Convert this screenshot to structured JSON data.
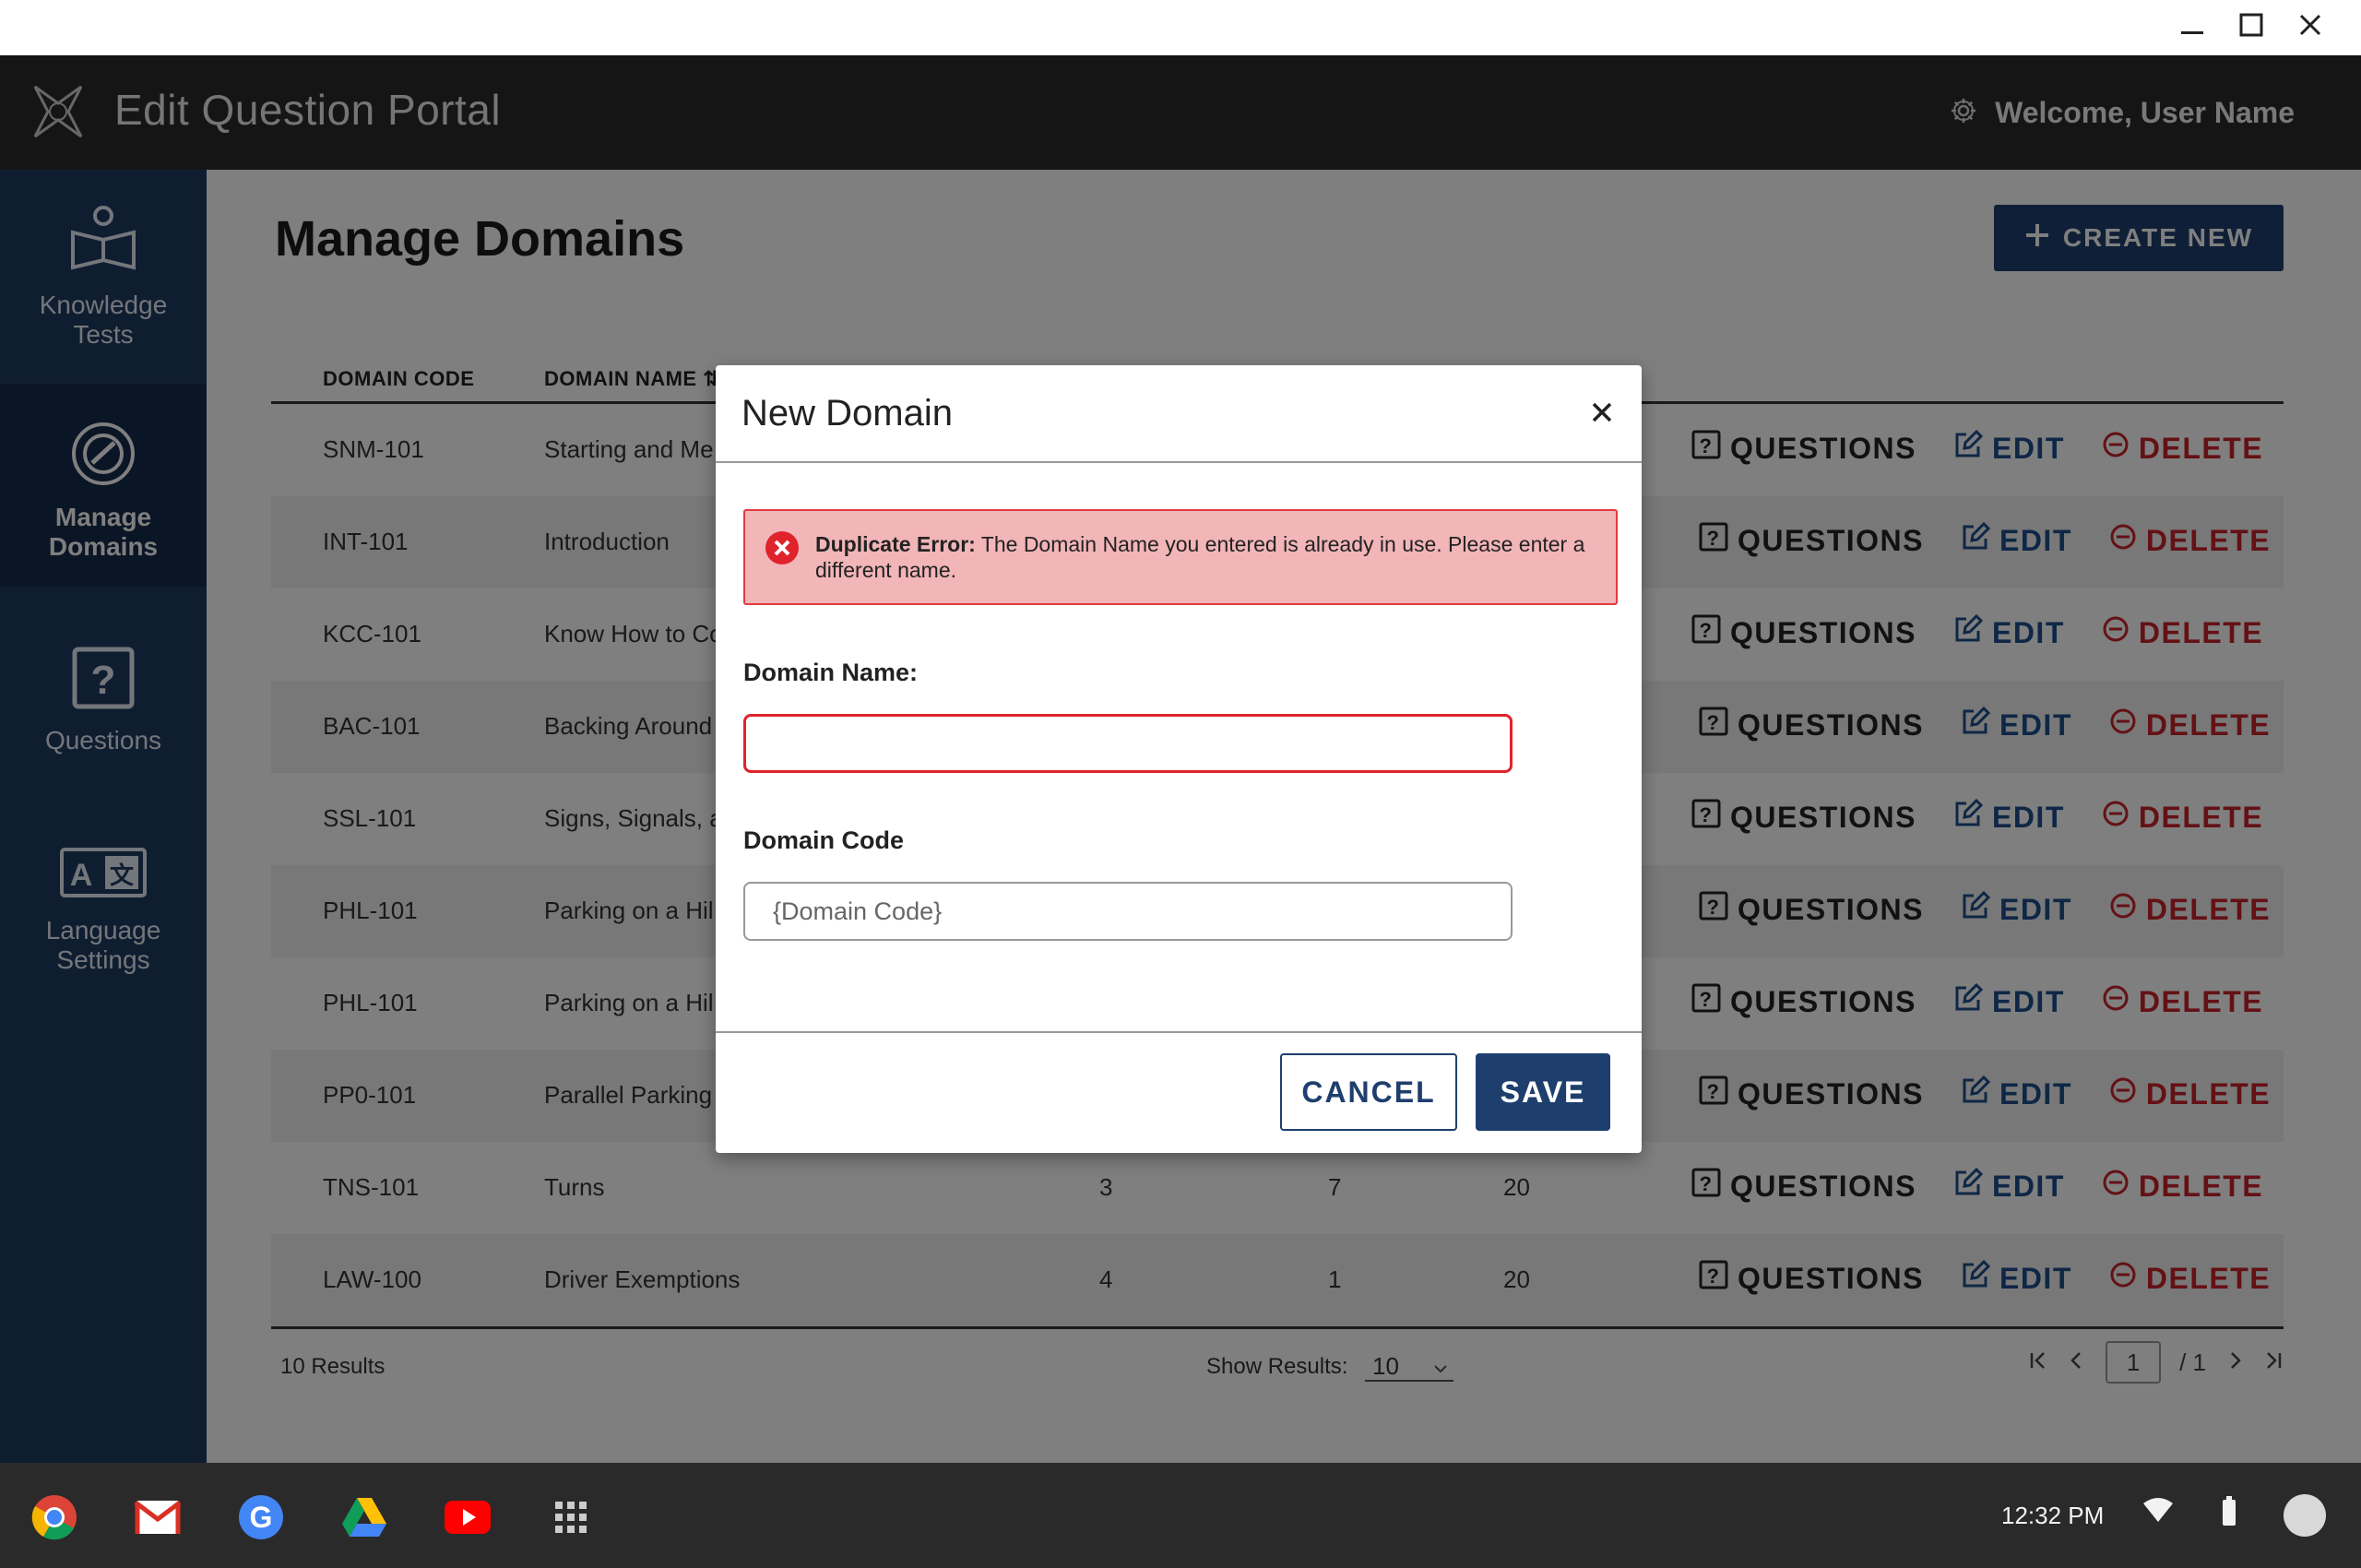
{
  "window": {
    "controls": [
      "minimize-icon",
      "maximize-icon",
      "close-icon"
    ]
  },
  "header": {
    "app_title": "Edit Question Portal",
    "welcome": "Welcome, User Name",
    "settings_icon": "gear-icon"
  },
  "sidebar": {
    "items": [
      {
        "label_line1": "Knowledge",
        "label_line2": "Tests",
        "icon": "book-user-icon",
        "active": false
      },
      {
        "label_line1": "Manage",
        "label_line2": "Domains",
        "icon": "target-icon",
        "active": true
      },
      {
        "label_line1": "Questions",
        "label_line2": "",
        "icon": "question-box-icon",
        "active": false
      },
      {
        "label_line1": "Language",
        "label_line2": "Settings",
        "icon": "translate-icon",
        "active": false
      }
    ]
  },
  "main": {
    "page_title": "Manage Domains",
    "create_button": "CREATE NEW"
  },
  "table": {
    "headers": {
      "domain_code": "DOMAIN CODE",
      "domain_name": "DOMAIN NAME"
    },
    "action_labels": {
      "questions": "QUESTIONS",
      "edit": "EDIT",
      "delete": "DELETE"
    },
    "rows": [
      {
        "code": "SNM-101",
        "name": "Starting and Me",
        "languages": "",
        "tests": "",
        "questions": ""
      },
      {
        "code": "INT-101",
        "name": "Introduction",
        "languages": "",
        "tests": "",
        "questions": ""
      },
      {
        "code": "KCC-101",
        "name": "Know How to Co",
        "languages": "",
        "tests": "",
        "questions": ""
      },
      {
        "code": "BAC-101",
        "name": "Backing Around",
        "languages": "",
        "tests": "",
        "questions": ""
      },
      {
        "code": "SSL-101",
        "name": "Signs, Signals, a",
        "languages": "",
        "tests": "",
        "questions": ""
      },
      {
        "code": "PHL-101",
        "name": "Parking on a Hil",
        "languages": "",
        "tests": "",
        "questions": ""
      },
      {
        "code": "PHL-101",
        "name": "Parking on a Hil",
        "languages": "",
        "tests": "",
        "questions": ""
      },
      {
        "code": "PP0-101",
        "name": "Parallel Parking",
        "languages": "",
        "tests": "",
        "questions": ""
      },
      {
        "code": "TNS-101",
        "name": "Turns",
        "languages": "3",
        "tests": "7",
        "questions": "20"
      },
      {
        "code": "LAW-100",
        "name": "Driver Exemptions",
        "languages": "4",
        "tests": "1",
        "questions": "20"
      }
    ]
  },
  "footer": {
    "results": "10 Results",
    "show_results_label": "Show Results:",
    "show_results_value": "10",
    "page_current": "1",
    "page_total": "/ 1"
  },
  "modal": {
    "title": "New Domain",
    "error_title": "Duplicate Error:",
    "error_message": " The Domain Name you entered is already in use. Please enter a different name.",
    "domain_name_label": "Domain Name:",
    "domain_name_value": "",
    "domain_code_label": "Domain Code",
    "domain_code_placeholder": "{Domain Code}",
    "cancel": "CANCEL",
    "save": "SAVE"
  },
  "taskbar": {
    "apps": [
      "chrome-icon",
      "gmail-icon",
      "google-icon",
      "drive-icon",
      "youtube-icon",
      "launcher-grid-icon"
    ],
    "time": "12:32 PM",
    "status_icons": [
      "wifi-icon",
      "battery-icon",
      "avatar"
    ]
  },
  "colors": {
    "header_bg": "#2b2b2b",
    "sidebar_bg": "#1f3b63",
    "primary": "#1e3f6e",
    "danger": "#c8222a",
    "error_bg": "#f2b5b8"
  }
}
